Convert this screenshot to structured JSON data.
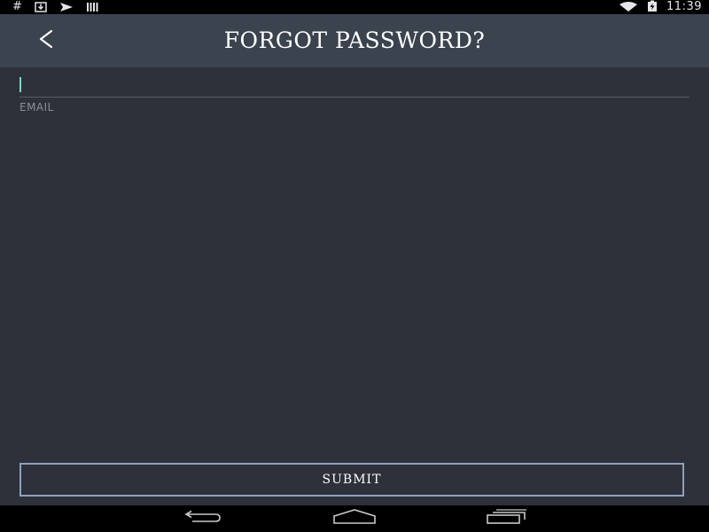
{
  "status_bar": {
    "time": "11:39",
    "left_icons": [
      "hash-icon",
      "download-icon",
      "send-icon",
      "barcode-icon"
    ],
    "right_icons": [
      "wifi-icon",
      "battery-charging-icon"
    ]
  },
  "header": {
    "title": "FORGOT PASSWORD?",
    "back_icon": "chevron-left-icon"
  },
  "form": {
    "email": {
      "label": "EMAIL",
      "value": "",
      "placeholder": ""
    },
    "submit_label": "SUBMIT"
  },
  "nav_bar": {
    "buttons": [
      "back-nav-icon",
      "home-nav-icon",
      "recents-nav-icon"
    ]
  },
  "colors": {
    "background": "#2e3139",
    "app_bar": "#3b434f",
    "accent_caret": "#7fd4c5",
    "button_border": "#8fa0bd"
  }
}
